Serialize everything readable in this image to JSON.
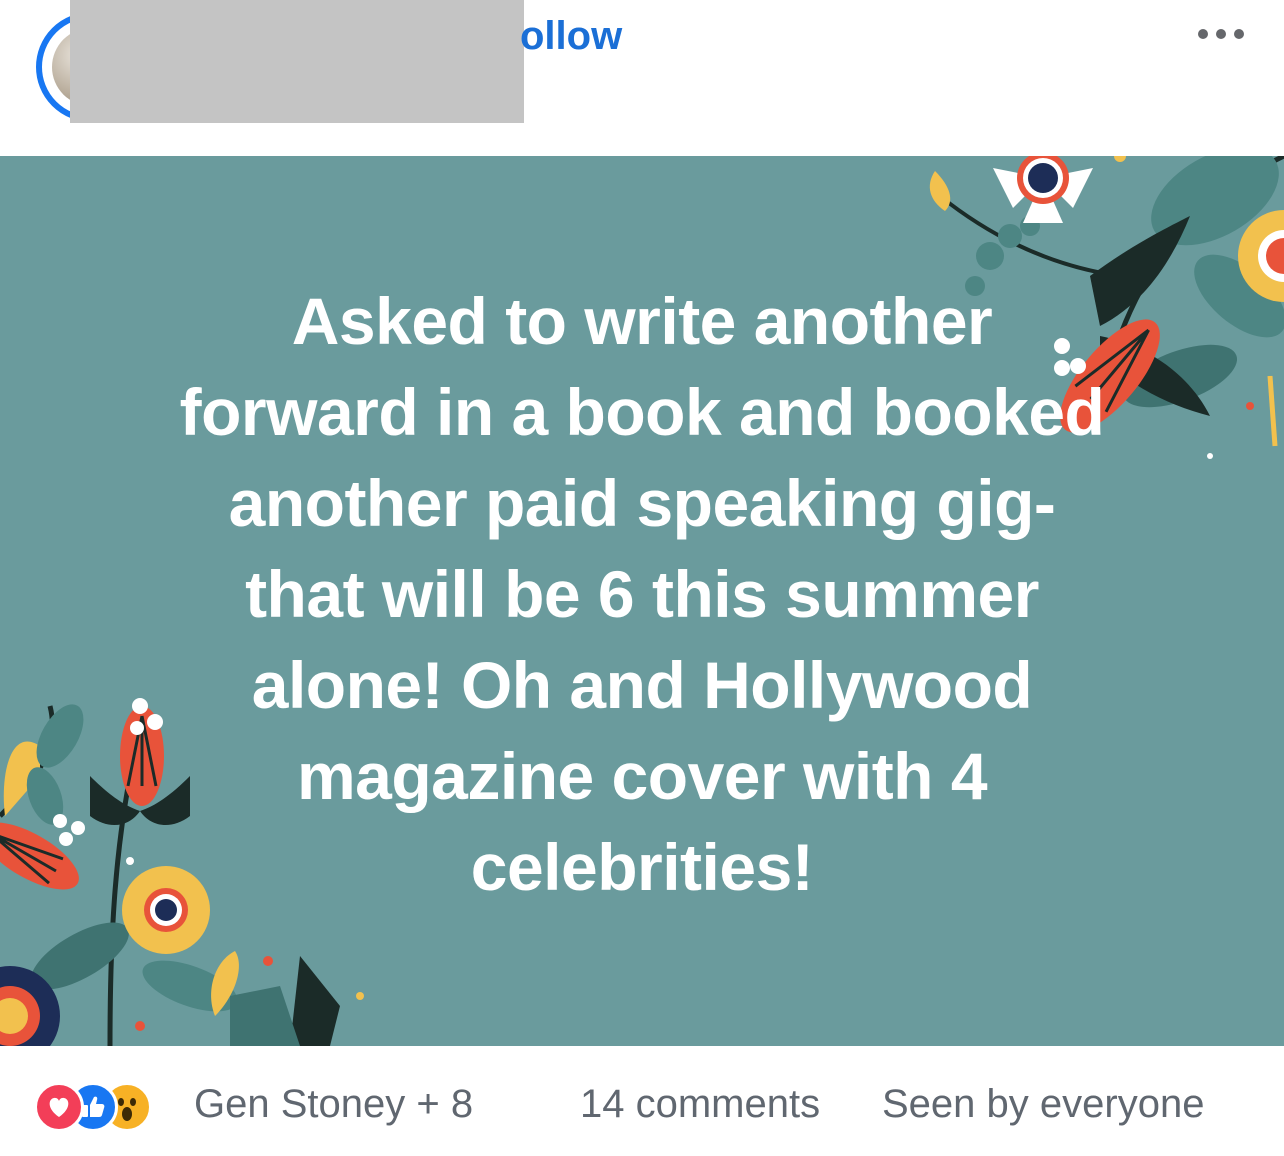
{
  "header": {
    "follow_label": "ollow",
    "more_icon": "more-horizontal-icon"
  },
  "post": {
    "background_color": "#6a9b9d",
    "text": "Asked to write another\nforward in a book and booked\nanother paid speaking gig-\nthat will be 6 this summer\nalone! Oh and Hollywood\nmagazine cover with 4\ncelebrities!"
  },
  "footer": {
    "reactions": [
      "love-icon",
      "like-icon",
      "wow-icon"
    ],
    "reaction_names": "Gen Stoney + 8",
    "comments": "14 comments",
    "seen_by": "Seen by everyone"
  },
  "colors": {
    "accent": "#1877f2",
    "link": "#1b6fd6",
    "meta_text": "#606770"
  }
}
